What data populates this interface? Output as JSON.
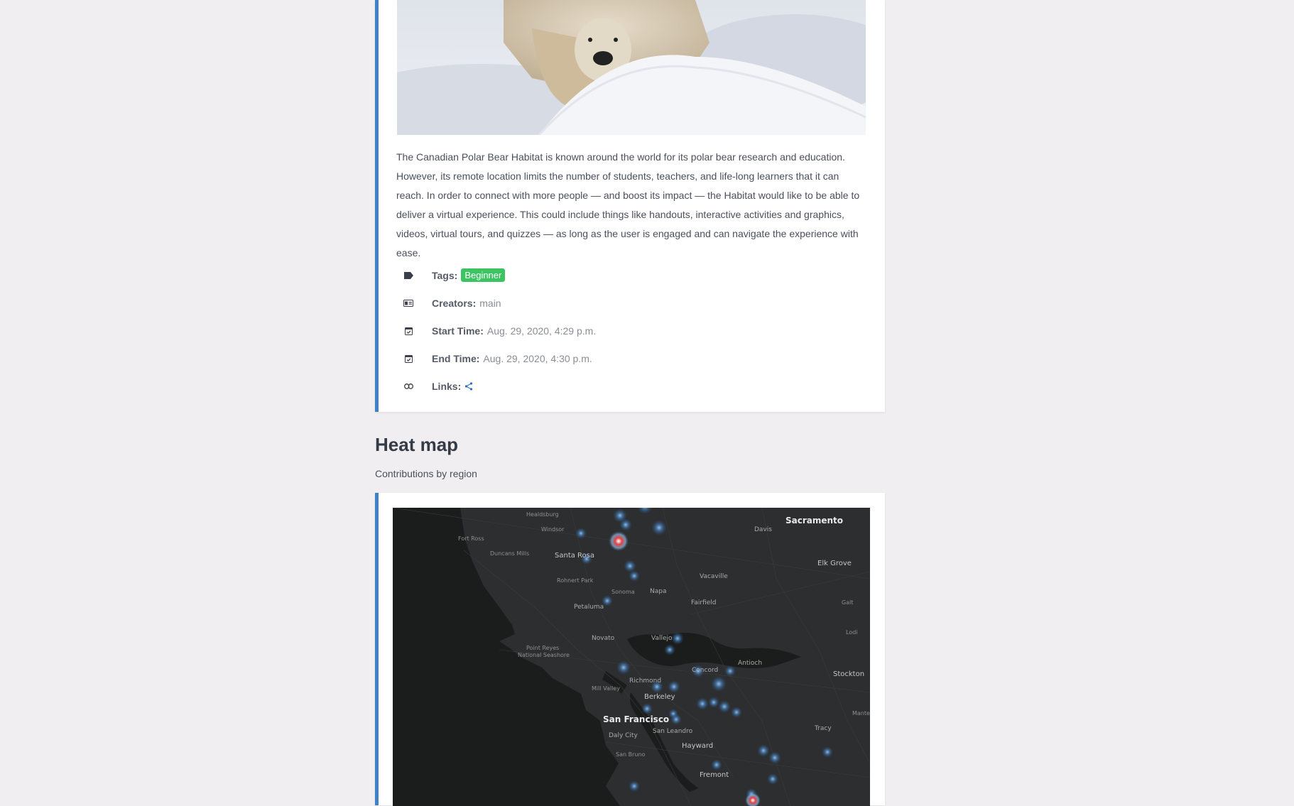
{
  "event": {
    "description": "The Canadian Polar Bear Habitat is known around the world for its polar bear research and education. However, its remote location limits the number of students, teachers, and life-long learners that it can reach. In order to connect with more people — and boost its impact — the Habitat would like to be able to deliver a virtual experience. This could include things like handouts, interactive activities and graphics, videos, virtual tours, and quizzes — as long as the user is engaged and can navigate the experience with ease.",
    "tags_label": "Tags:",
    "tag": "Beginner",
    "creators_label": "Creators:",
    "creators": "main",
    "start_label": "Start Time:",
    "start": "Aug. 29, 2020, 4:29 p.m.",
    "end_label": "End Time:",
    "end": "Aug. 29, 2020, 4:30 p.m.",
    "links_label": "Links:"
  },
  "heatmap": {
    "title": "Heat map",
    "subtitle": "Contributions by region",
    "places": {
      "healdsburg": "Healdsburg",
      "windsor": "Windsor",
      "fort_ross": "Fort Ross",
      "duncans_mills": "Duncans Mills",
      "santa_rosa": "Santa Rosa",
      "rohnert_park": "Rohnert Park",
      "sonoma": "Sonoma",
      "napa": "Napa",
      "petaluma": "Petaluma",
      "novato": "Novato",
      "vallejo": "Vallejo",
      "point_reyes_1": "Point Reyes",
      "point_reyes_2": "National Seashore",
      "richmond": "Richmond",
      "mill_valley": "Mill Valley",
      "berkeley": "Berkeley",
      "san_francisco": "San Francisco",
      "daly_city": "Daly City",
      "san_bruno": "San Bruno",
      "san_leandro": "San Leandro",
      "hayward": "Hayward",
      "fremont": "Fremont",
      "concord": "Concord",
      "antioch": "Antioch",
      "davis": "Davis",
      "sacramento": "Sacramento",
      "elk_grove": "Elk Grove",
      "vacaville": "Vacaville",
      "fairfield": "Fairfield",
      "galt": "Galt",
      "lodi": "Lodi",
      "stockton": "Stockton",
      "tracy": "Tracy",
      "manteca": "Mante"
    }
  }
}
